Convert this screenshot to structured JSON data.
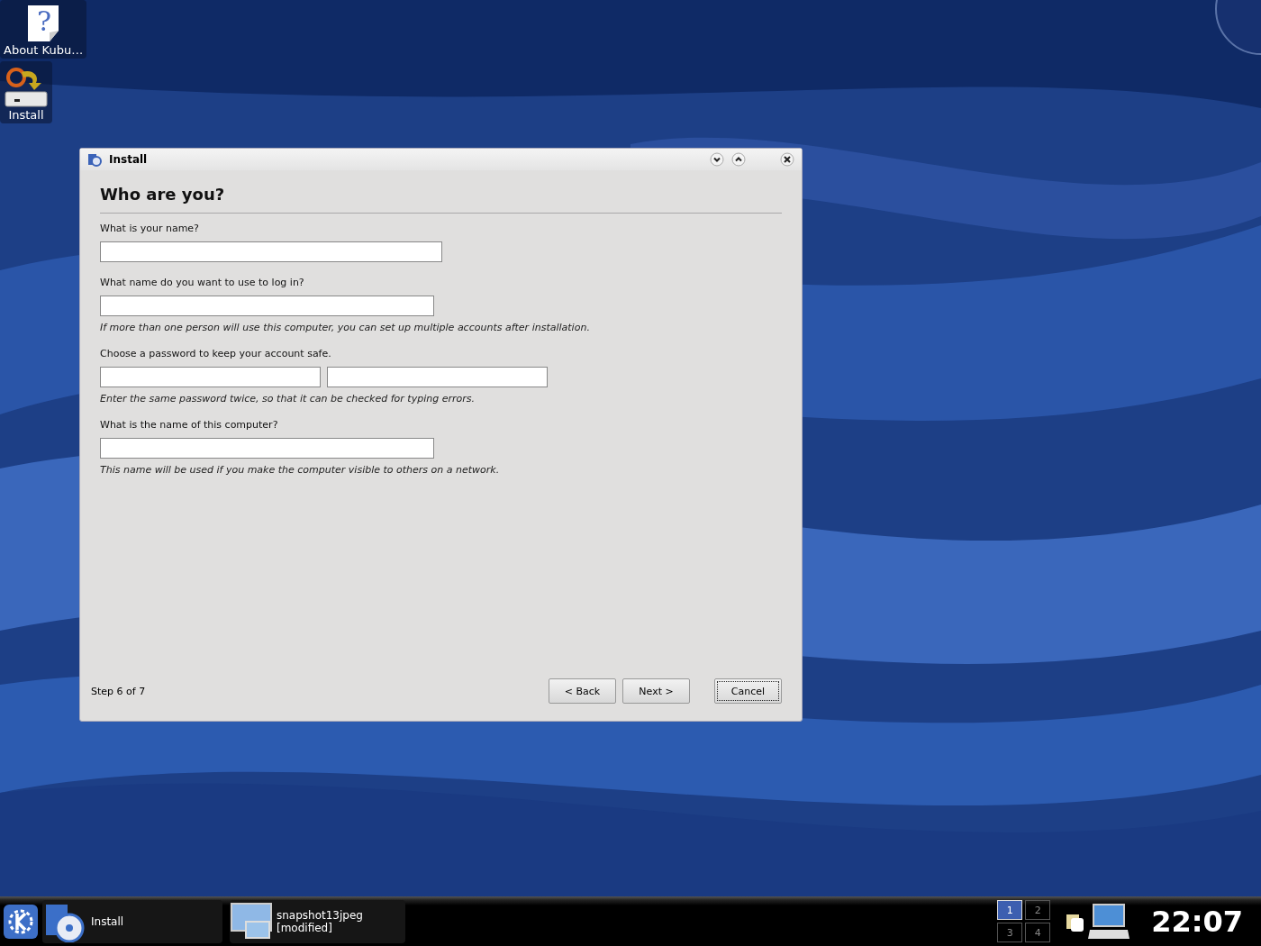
{
  "desktop_icons": [
    {
      "label": "About Kubu…",
      "kind": "help",
      "glyph": "?"
    },
    {
      "label": "Install",
      "kind": "install"
    }
  ],
  "window": {
    "title": "Install",
    "heading": "Who are you?",
    "sections": [
      {
        "label": "What is your name?",
        "kind": "single"
      },
      {
        "label": "What name do you want to use to log in?",
        "kind": "single",
        "hint": "If more than one person will use this computer, you can set up multiple accounts after installation."
      },
      {
        "label": "Choose a password to keep your account safe.",
        "kind": "double",
        "hint": "Enter the same password twice, so that it can be checked for typing errors."
      },
      {
        "label": "What is the name of this computer?",
        "kind": "single",
        "hint": "This name will be used if you make the computer visible to others on a network."
      }
    ],
    "step": "Step 6 of 7",
    "buttons": [
      {
        "label": "< Back",
        "focused": false
      },
      {
        "label": "Next >",
        "focused": false
      },
      {
        "label": "Cancel",
        "focused": true
      }
    ]
  },
  "taskbar": {
    "tasks": [
      {
        "kind": "install",
        "lines": [
          "Install"
        ]
      },
      {
        "lines": [
          "snapshot13jpeg",
          "[modified]"
        ]
      }
    ],
    "pager": [
      {
        "label": "1",
        "selected": true
      },
      {
        "label": "2",
        "selected": false
      },
      {
        "label": "3",
        "selected": false
      },
      {
        "label": "4",
        "selected": false
      }
    ],
    "clock": "22:07"
  }
}
